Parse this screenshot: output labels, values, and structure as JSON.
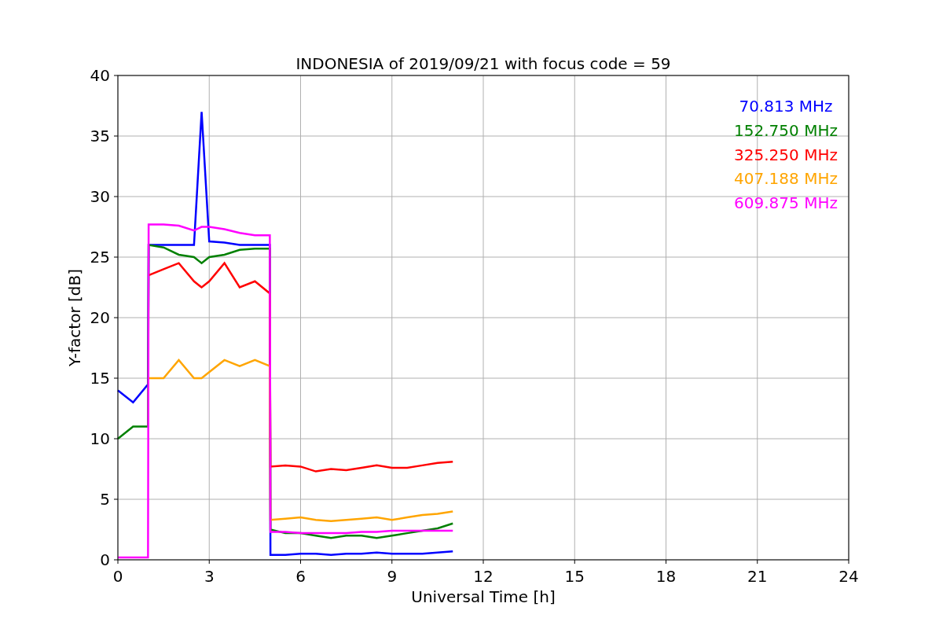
{
  "chart_data": {
    "type": "line",
    "title": "INDONESIA of 2019/09/21 with focus code = 59",
    "xlabel": "Universal Time [h]",
    "ylabel": "Y-factor [dB]",
    "x": [
      0,
      0.5,
      0.99,
      1.01,
      1.5,
      2,
      2.5,
      2.75,
      3,
      3.5,
      4,
      4.5,
      4.99,
      5.01,
      5.5,
      6,
      6.5,
      7,
      7.5,
      8,
      8.5,
      9,
      9.5,
      10,
      10.5,
      11
    ],
    "series": [
      {
        "name": "70.813 MHz",
        "color": "#0000ff",
        "values": [
          14,
          13,
          14.5,
          26,
          26,
          26,
          26,
          37,
          26.3,
          26.2,
          26,
          26,
          26,
          0.4,
          0.4,
          0.5,
          0.5,
          0.4,
          0.5,
          0.5,
          0.6,
          0.5,
          0.5,
          0.5,
          0.6,
          0.7
        ]
      },
      {
        "name": "152.750 MHz",
        "color": "#008000",
        "values": [
          10,
          11,
          11,
          26,
          25.8,
          25.2,
          25,
          24.5,
          25,
          25.2,
          25.6,
          25.7,
          25.7,
          2.5,
          2.2,
          2.2,
          2,
          1.8,
          2,
          2,
          1.8,
          2,
          2.2,
          2.4,
          2.6,
          3
        ]
      },
      {
        "name": "325.250 MHz",
        "color": "#ff0000",
        "values": [
          null,
          null,
          null,
          23.5,
          24,
          24.5,
          23,
          22.5,
          23,
          24.5,
          22.5,
          23,
          22,
          7.7,
          7.8,
          7.7,
          7.3,
          7.5,
          7.4,
          7.6,
          7.8,
          7.6,
          7.6,
          7.8,
          8,
          8.1
        ]
      },
      {
        "name": "407.188 MHz",
        "color": "#ffa500",
        "values": [
          null,
          null,
          null,
          15,
          15,
          16.5,
          15,
          15,
          15.5,
          16.5,
          16,
          16.5,
          16,
          3.3,
          3.4,
          3.5,
          3.3,
          3.2,
          3.3,
          3.4,
          3.5,
          3.3,
          3.5,
          3.7,
          3.8,
          4
        ]
      },
      {
        "name": "609.875 MHz",
        "color": "#ff00ff",
        "values": [
          0.2,
          0.2,
          0.2,
          27.7,
          27.7,
          27.6,
          27.2,
          27.5,
          27.5,
          27.3,
          27,
          26.8,
          26.8,
          2.3,
          2.3,
          2.2,
          2.2,
          2.2,
          2.2,
          2.3,
          2.3,
          2.4,
          2.4,
          2.4,
          2.4,
          2.4
        ]
      }
    ],
    "grid": true,
    "xlim": [
      0,
      24
    ],
    "ylim": [
      0,
      40
    ],
    "xticks": [
      0,
      3,
      6,
      9,
      12,
      15,
      18,
      21,
      24
    ],
    "yticks": [
      0,
      5,
      10,
      15,
      20,
      25,
      30,
      35,
      40
    ]
  }
}
